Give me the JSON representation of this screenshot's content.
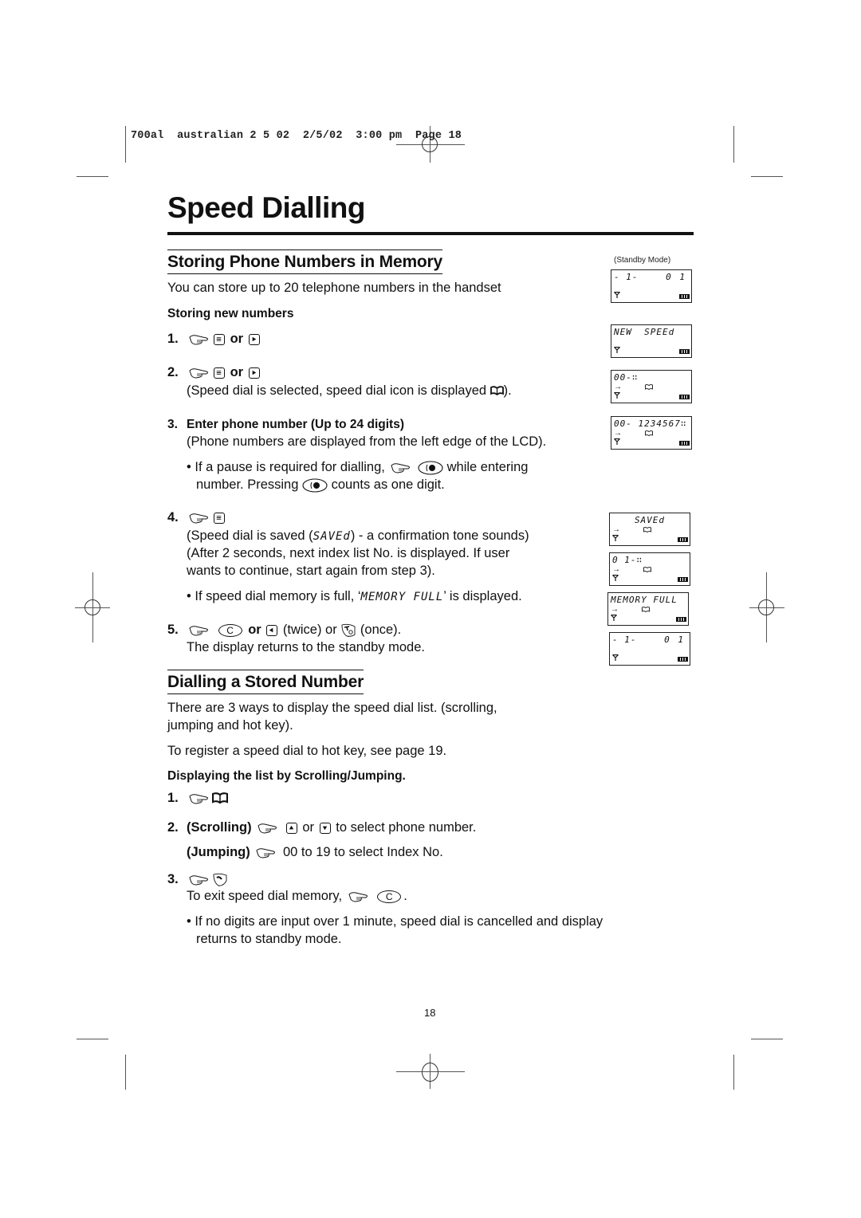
{
  "slug": {
    "text": "700al  australian 2 5 02  2/5/02  3:00 pm  Page 18"
  },
  "page": {
    "title": "Speed Dialling",
    "number": "18"
  },
  "section1": {
    "heading": "Storing Phone Numbers in Memory",
    "intro": "You can store up to 20 telephone numbers in the handset",
    "subheading": "Storing new numbers",
    "steps": [
      {
        "num": "1.",
        "or_label": "or",
        "icons": [
          "hand-press-icon",
          "menu-key-icon",
          "right-arrow-key-icon"
        ]
      },
      {
        "num": "2.",
        "or_label": "or",
        "icons": [
          "hand-press-icon",
          "menu-key-icon",
          "right-arrow-key-icon"
        ],
        "note": "(Speed dial is selected, speed dial icon is displayed ",
        "note_end": ")."
      },
      {
        "num": "3.",
        "label": "Enter phone number (Up to 24 digits)",
        "note": "(Phone numbers are displayed from the left edge of the LCD).",
        "bullet_a": "If a pause is required for dialling,",
        "bullet_b": "while entering",
        "bullet_c": "number. Pressing",
        "bullet_d": "counts as one digit."
      },
      {
        "num": "4.",
        "note1_a": "(Speed dial is saved (",
        "note1_lcd": "SAVEd",
        "note1_b": ") - a confirmation tone sounds)",
        "note2": "(After 2 seconds, next index list No. is displayed. If user",
        "note3": "wants to continue, start again from step 3).",
        "bullet_a": "If speed dial memory is full, ‘",
        "bullet_lcd": "MEMORY FULL",
        "bullet_b": "’ is displayed."
      },
      {
        "num": "5.",
        "key_c": "C",
        "or_label": "or",
        "twice": "(twice) or",
        "once": "(once).",
        "note": "The display returns to the standby mode."
      }
    ]
  },
  "section2": {
    "heading": "Dialling a Stored Number",
    "intro1": "There are 3 ways to display the speed dial list. (scrolling,",
    "intro2": "jumping and hot key).",
    "intro3": "To register a speed dial to hot key, see page 19.",
    "subheading": "Displaying the list by Scrolling/Jumping.",
    "steps": [
      {
        "num": "1."
      },
      {
        "num": "2.",
        "label": "(Scrolling)",
        "or_label": "or",
        "text": "to select phone number.",
        "label2": "(Jumping)",
        "text2": "00 to 19 to select Index No."
      },
      {
        "num": "3.",
        "note": "To exit speed dial memory,",
        "key_c": "C",
        "note_end": "."
      }
    ],
    "bullet1": "If no digits are input over 1 minute, speed dial is cancelled and display",
    "bullet2": "returns to standby mode."
  },
  "lcd_panel": {
    "caption": "(Standby Mode)",
    "screens": [
      {
        "line1_left": "- 1-",
        "line1_right": "0 1",
        "arrow": false,
        "book": false
      },
      {
        "line1_left": "NEW  SPEEd",
        "line1_right": "",
        "arrow": false,
        "book": false
      },
      {
        "line1_left": "00-∷",
        "line1_right": "",
        "arrow": true,
        "book": true
      },
      {
        "line1_left": "00- 1234567∷",
        "line1_right": "",
        "arrow": true,
        "book": true
      },
      {
        "line1_center": "SAVEd",
        "arrow": true,
        "book": true
      },
      {
        "line1_left": "0 1-∷",
        "line1_right": "",
        "arrow": true,
        "book": true
      },
      {
        "line1_left": "MEMORY FULL",
        "line1_right": "",
        "arrow": true,
        "book": true
      },
      {
        "line1_left": "- 1-",
        "line1_right": "0 1",
        "arrow": false,
        "book": false
      }
    ]
  }
}
